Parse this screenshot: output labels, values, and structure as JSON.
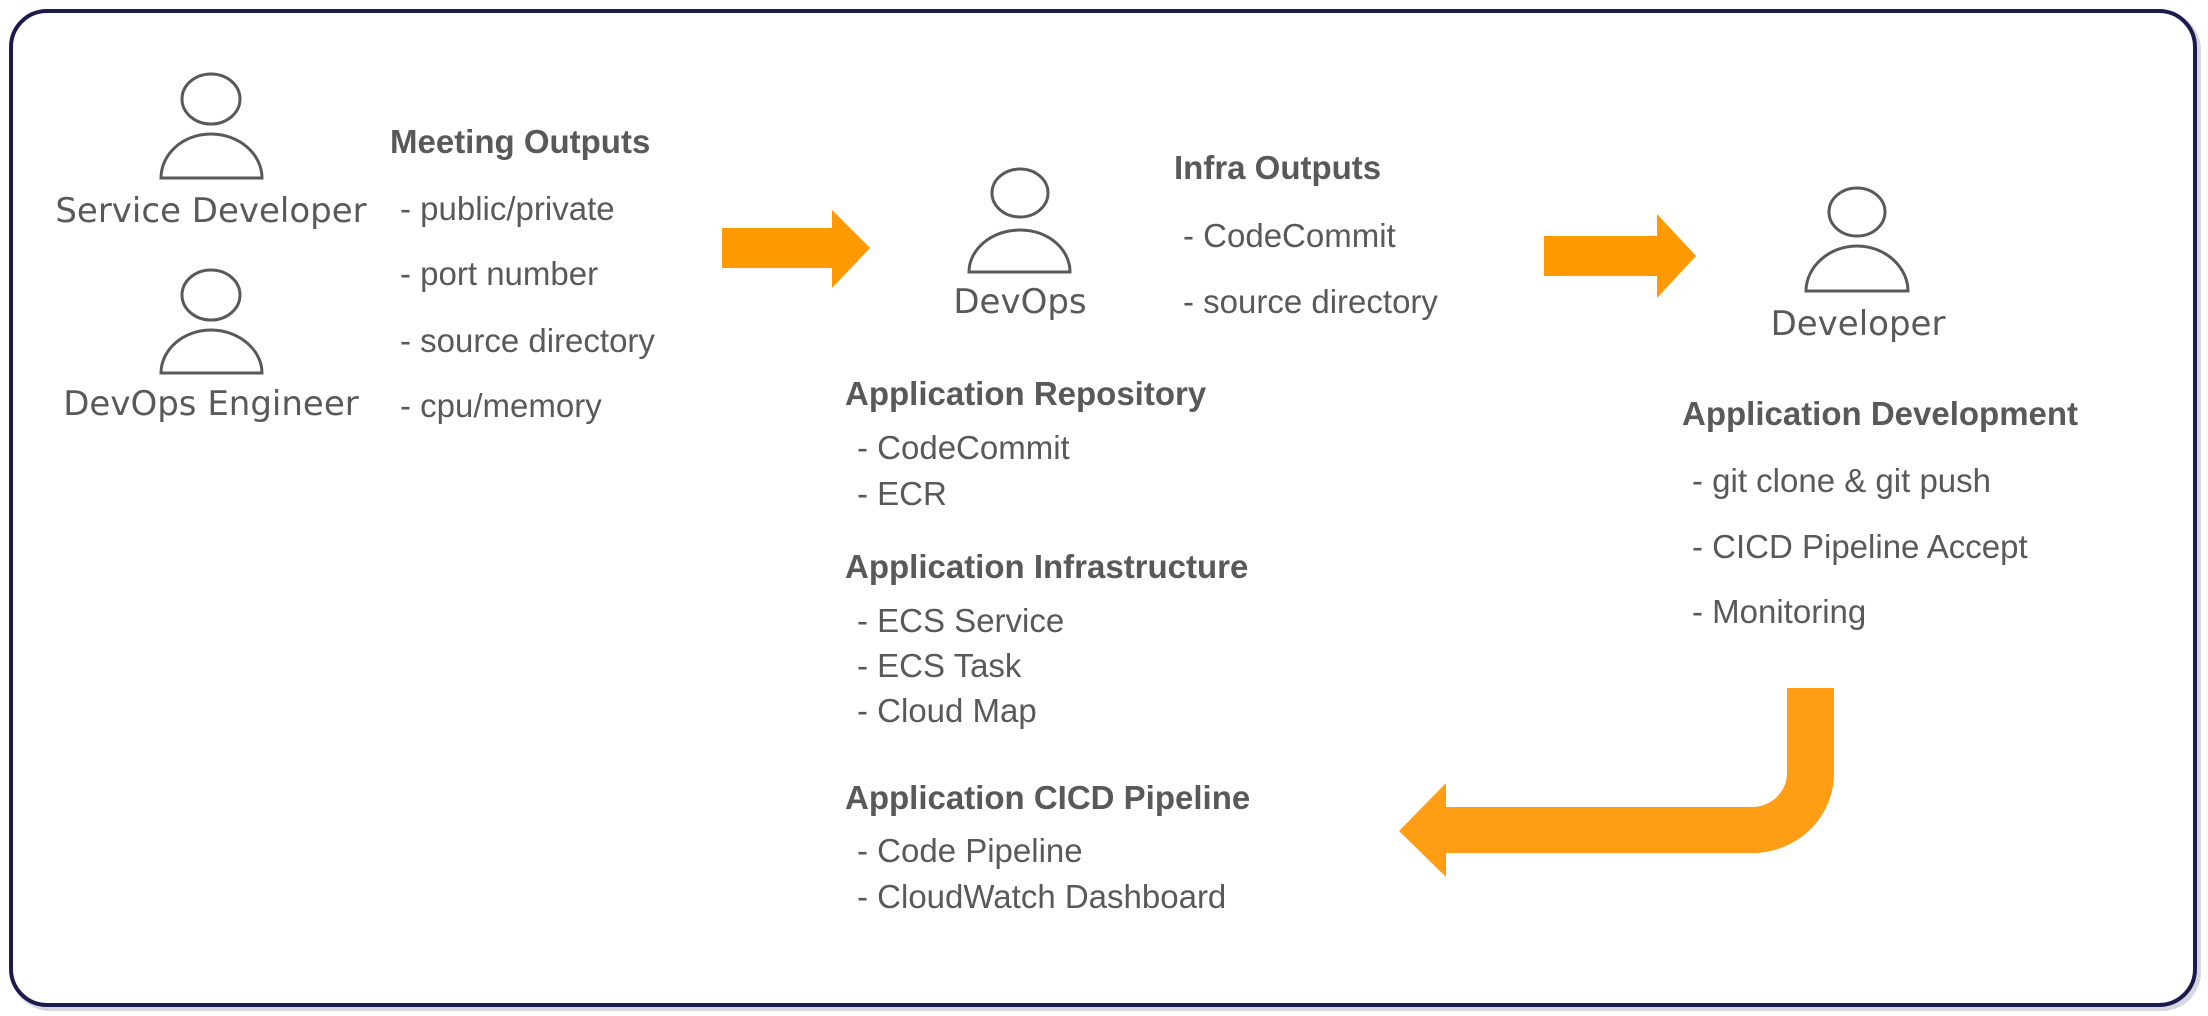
{
  "diagram": {
    "accent_color": "#FF9900",
    "text_color": "#595959",
    "border_color": "#1B1B4D",
    "actors": {
      "service_developer": {
        "label": "Service Developer",
        "icon": "person-icon"
      },
      "devops_engineer": {
        "label": "DevOps Engineer",
        "icon": "person-icon"
      },
      "devops": {
        "label": "DevOps",
        "icon": "person-icon"
      },
      "developer": {
        "label": "Developer",
        "icon": "person-icon"
      }
    },
    "meeting_outputs": {
      "title": "Meeting Outputs",
      "items": [
        "- public/private",
        "- port number",
        "- source directory",
        "- cpu/memory"
      ]
    },
    "infra_outputs": {
      "title": "Infra Outputs",
      "items": [
        "- CodeCommit",
        "- source directory"
      ]
    },
    "application_repository": {
      "title": "Application Repository",
      "items": [
        "- CodeCommit",
        "- ECR"
      ]
    },
    "application_infrastructure": {
      "title": "Application Infrastructure",
      "items": [
        "- ECS Service",
        "- ECS Task",
        "- Cloud Map"
      ]
    },
    "application_cicd_pipeline": {
      "title": "Application CICD Pipeline",
      "items": [
        "- Code Pipeline",
        "- CloudWatch Dashboard"
      ]
    },
    "application_development": {
      "title": "Application Development",
      "items": [
        "- git clone & git push",
        "- CICD Pipeline Accept",
        "- Monitoring"
      ]
    },
    "flows": [
      {
        "from": "Meeting Outputs",
        "to": "DevOps",
        "direction": "right"
      },
      {
        "from": "Infra Outputs",
        "to": "Developer",
        "direction": "right"
      },
      {
        "from": "Application Development",
        "to": "Application CICD Pipeline",
        "direction": "down-left"
      }
    ]
  }
}
